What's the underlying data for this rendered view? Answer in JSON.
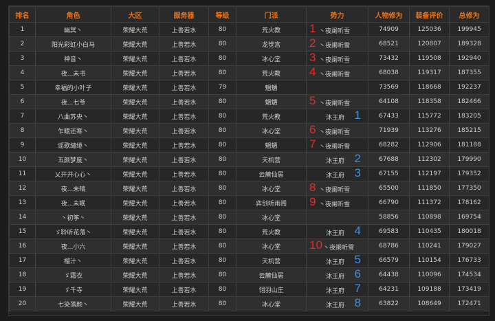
{
  "columns": [
    "排名",
    "角色",
    "大区",
    "服务器",
    "等级",
    "门派",
    "势力",
    "人物修为",
    "装备评价",
    "总修为"
  ],
  "rows": [
    {
      "rank": "1",
      "role": "幽冥丶",
      "region": "荣耀大荒",
      "server": "上善若水",
      "level": "80",
      "sect": "荒火教",
      "faction": "丶夜阑听雪",
      "mark": "1",
      "mark_color": "red",
      "cult": "74909",
      "equip": "125036",
      "total": "199945"
    },
    {
      "rank": "2",
      "role": "阳光彩虹小白马",
      "region": "荣耀大荒",
      "server": "上善若水",
      "level": "80",
      "sect": "龙觉宫",
      "faction": "丶夜阑听雪",
      "mark": "2",
      "mark_color": "red",
      "cult": "68521",
      "equip": "120807",
      "total": "189328"
    },
    {
      "rank": "3",
      "role": "神音丶",
      "region": "荣耀大荒",
      "server": "上善若水",
      "level": "80",
      "sect": "冰心堂",
      "faction": "丶夜阑听雪",
      "mark": "3",
      "mark_color": "red",
      "cult": "73432",
      "equip": "119508",
      "total": "192940"
    },
    {
      "rank": "4",
      "role": "夜...未书",
      "region": "荣耀大荒",
      "server": "上善若水",
      "level": "80",
      "sect": "荒火教",
      "faction": "丶夜阑听雪",
      "mark": "4",
      "mark_color": "red",
      "cult": "68038",
      "equip": "119317",
      "total": "187355"
    },
    {
      "rank": "5",
      "role": "幸福的小叶子",
      "region": "荣耀大荒",
      "server": "上善若水",
      "level": "79",
      "sect": "魍魉",
      "faction": "",
      "mark": "",
      "mark_color": "",
      "cult": "73569",
      "equip": "118668",
      "total": "192237"
    },
    {
      "rank": "6",
      "role": "夜...七爷",
      "region": "荣耀大荒",
      "server": "上善若水",
      "level": "80",
      "sect": "魍魉",
      "faction": "丶夜阑听雪",
      "mark": "5",
      "mark_color": "red",
      "cult": "64108",
      "equip": "118358",
      "total": "182466"
    },
    {
      "rank": "7",
      "role": "八曲苏央丶",
      "region": "荣耀大荒",
      "server": "上善若水",
      "level": "80",
      "sect": "荒火教",
      "faction": "沐王府",
      "mark": "1",
      "mark_color": "blue",
      "cult": "67433",
      "equip": "115772",
      "total": "183205"
    },
    {
      "rank": "8",
      "role": "乍暖还寒丶",
      "region": "荣耀大荒",
      "server": "上善若水",
      "level": "80",
      "sect": "冰心堂",
      "faction": "丶夜阑听雪",
      "mark": "6",
      "mark_color": "red",
      "cult": "71939",
      "equip": "113276",
      "total": "185215"
    },
    {
      "rank": "9",
      "role": "谣歌缱绻丶",
      "region": "荣耀大荒",
      "server": "上善若水",
      "level": "80",
      "sect": "魍魉",
      "faction": "丶夜阑听雪",
      "mark": "7",
      "mark_color": "red",
      "cult": "68282",
      "equip": "112906",
      "total": "181188"
    },
    {
      "rank": "10",
      "role": "五颜梦度丶",
      "region": "荣耀大荒",
      "server": "上善若水",
      "level": "80",
      "sect": "天机营",
      "faction": "沐王府",
      "mark": "2",
      "mark_color": "blue",
      "cult": "67688",
      "equip": "112302",
      "total": "179990"
    },
    {
      "rank": "11",
      "role": "乂开开心心丶",
      "region": "荣耀大荒",
      "server": "上善若水",
      "level": "80",
      "sect": "云麓仙居",
      "faction": "沐王府",
      "mark": "3",
      "mark_color": "blue",
      "cult": "67155",
      "equip": "112197",
      "total": "179352"
    },
    {
      "rank": "12",
      "role": "夜...未晴",
      "region": "荣耀大荒",
      "server": "上善若水",
      "level": "80",
      "sect": "冰心堂",
      "faction": "丶夜阑听雪",
      "mark": "8",
      "mark_color": "red",
      "cult": "65500",
      "equip": "111850",
      "total": "177350"
    },
    {
      "rank": "13",
      "role": "夜...未眠",
      "region": "荣耀大荒",
      "server": "上善若水",
      "level": "80",
      "sect": "弈剑听雨阁",
      "faction": "丶夜阑听雪",
      "mark": "9",
      "mark_color": "red",
      "cult": "66790",
      "equip": "111372",
      "total": "178162"
    },
    {
      "rank": "14",
      "role": "丶初筝丶",
      "region": "荣耀大荒",
      "server": "上善若水",
      "level": "80",
      "sect": "冰心堂",
      "faction": "",
      "mark": "",
      "mark_color": "",
      "cult": "58856",
      "equip": "110898",
      "total": "169754"
    },
    {
      "rank": "15",
      "role": "ゞ聆听花落丶",
      "region": "荣耀大荒",
      "server": "上善若水",
      "level": "80",
      "sect": "荒火教",
      "faction": "沐王府",
      "mark": "4",
      "mark_color": "blue",
      "cult": "69583",
      "equip": "110435",
      "total": "180018"
    },
    {
      "rank": "16",
      "role": "夜...小六",
      "region": "荣耀大荒",
      "server": "上善若水",
      "level": "80",
      "sect": "冰心堂",
      "faction": "丶夜阑听雪",
      "mark": "10",
      "mark_color": "red",
      "cult": "68786",
      "equip": "110241",
      "total": "179027"
    },
    {
      "rank": "17",
      "role": "榴汁丶",
      "region": "荣耀大荒",
      "server": "上善若水",
      "level": "80",
      "sect": "天机营",
      "faction": "沐王府",
      "mark": "5",
      "mark_color": "blue",
      "cult": "66579",
      "equip": "110154",
      "total": "176733"
    },
    {
      "rank": "18",
      "role": "ゞ霜衣",
      "region": "荣耀大荒",
      "server": "上善若水",
      "level": "80",
      "sect": "云麓仙居",
      "faction": "沐王府",
      "mark": "6",
      "mark_color": "blue",
      "cult": "64438",
      "equip": "110096",
      "total": "174534"
    },
    {
      "rank": "19",
      "role": "ゞ千寺",
      "region": "荣耀大荒",
      "server": "上善若水",
      "level": "80",
      "sect": "翎羽山庄",
      "faction": "沐王府",
      "mark": "7",
      "mark_color": "blue",
      "cult": "64231",
      "equip": "109188",
      "total": "173419"
    },
    {
      "rank": "20",
      "role": "七染落颜丶",
      "region": "荣耀大荒",
      "server": "上善若水",
      "level": "80",
      "sect": "冰心堂",
      "faction": "沐王府",
      "mark": "8",
      "mark_color": "blue",
      "cult": "63822",
      "equip": "108649",
      "total": "172471"
    }
  ],
  "colors": {
    "header_text": "#e8731c",
    "red_mark": "#e62a2a",
    "blue_mark": "#3d8fe0"
  }
}
